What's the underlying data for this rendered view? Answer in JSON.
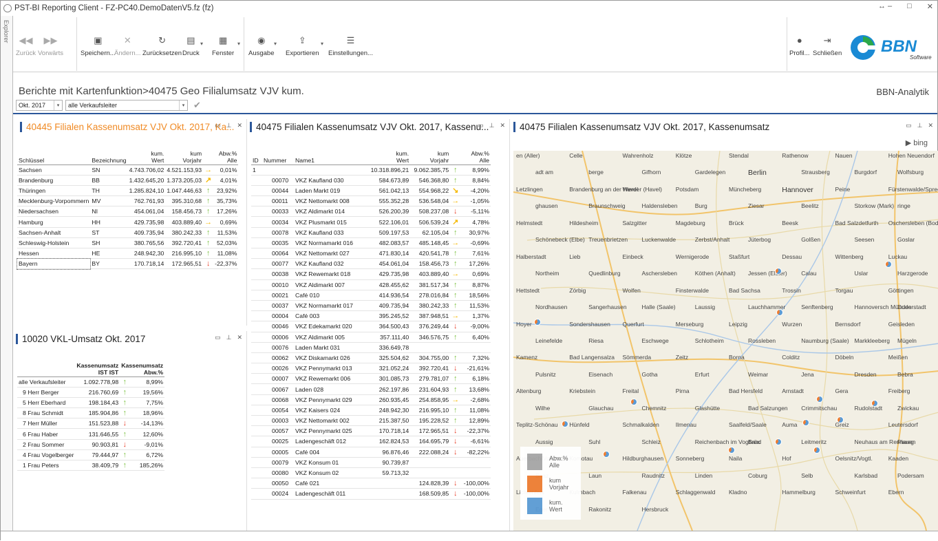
{
  "window": {
    "title": "PST-BI Reporting Client - FZ-PC40.DemoDatenV5.fz (fz)",
    "controls": [
      "↔ –",
      "□",
      "✕"
    ]
  },
  "explorer": {
    "label": "Explorer"
  },
  "toolbar": {
    "back": "Zurück",
    "forward": "Vorwärts",
    "save": "Speichern...",
    "edit": "Ändern...",
    "reset": "Zurücksetzen",
    "print": "Druck",
    "window": "Fenster",
    "output": "Ausgabe",
    "export": "Exportieren",
    "settings": "Einstellungen...",
    "profile": "Profil...",
    "close": "Schließen"
  },
  "logo": {
    "text": "BBN",
    "sub": "Software",
    "color": "#1a8ad4",
    "accent": "#2ba84a"
  },
  "breadcrumb": "Berichte mit Kartenfunktion>40475 Geo Filialumsatz VJV kum.",
  "brand_right": "BBN-Analytik",
  "filters": {
    "period": "Okt. 2017",
    "manager": "alle Verkaufsleiter"
  },
  "panel1": {
    "title": "40445 Filialen Kassenumsatz VJV Okt. 2017, Ka...",
    "headers": [
      "Schlüssel",
      "Bezeichnung",
      "kum.\nWert",
      "kum\nVorjahr",
      "Abw.%\nAlle"
    ],
    "rows": [
      [
        "Sachsen",
        "SN",
        "4.743.706,02",
        "4.521.153,93",
        "rt",
        "0,01%"
      ],
      [
        "Brandenburg",
        "BB",
        "1.432.645,20",
        "1.373.205,03",
        "ur",
        "4,01%"
      ],
      [
        "Thüringen",
        "TH",
        "1.285.824,10",
        "1.047.446,63",
        "up",
        "23,92%"
      ],
      [
        "Mecklenburg-Vorpommern",
        "MV",
        "762.761,93",
        "395.310,68",
        "up",
        "35,73%"
      ],
      [
        "Niedersachsen",
        "NI",
        "454.061,04",
        "158.456,73",
        "up",
        "17,26%"
      ],
      [
        "Hamburg",
        "HH",
        "429.735,98",
        "403.889,40",
        "rt",
        "0,69%"
      ],
      [
        "Sachsen-Anhalt",
        "ST",
        "409.735,94",
        "380.242,33",
        "up",
        "11,53%"
      ],
      [
        "Schleswig-Holstein",
        "SH",
        "380.765,56",
        "392.720,41",
        "up",
        "52,03%"
      ],
      [
        "Hessen",
        "HE",
        "248.942,30",
        "216.995,10",
        "up",
        "11,08%"
      ],
      [
        "Bayern",
        "BY",
        "170.718,14",
        "172.965,51",
        "dn",
        "-22,37%"
      ]
    ]
  },
  "panel2": {
    "title": "10020 VKL-Umsatz Okt. 2017",
    "headers": [
      "",
      "Kassenumsatz\nIST IST",
      "Kassenumsatz\nAbw.%"
    ],
    "rows": [
      [
        "alle Verkaufsleiter",
        "1.092.778,98",
        "up",
        "8,99%"
      ],
      [
        "9 Herr Berger",
        "216.760,69",
        "up",
        "19,56%"
      ],
      [
        "5 Herr Eberhard",
        "198.184,43",
        "up",
        "7,75%"
      ],
      [
        "8 Frau Schmidt",
        "185.904,86",
        "up",
        "18,96%"
      ],
      [
        "7 Herr Müller",
        "151.523,88",
        "dn",
        "-14,13%"
      ],
      [
        "6 Frau Haber",
        "131.646,55",
        "up",
        "12,60%"
      ],
      [
        "2 Frau Sommer",
        "90.903,81",
        "dn",
        "-9,01%"
      ],
      [
        "4 Frau Vogelberger",
        "79.444,97",
        "up",
        "6,72%"
      ],
      [
        "1 Frau Peters",
        "38.409,79",
        "up",
        "185,26%"
      ]
    ]
  },
  "panel3": {
    "title": "40475 Filialen Kassenumsatz VJV Okt. 2017, Kassenu...",
    "headers": [
      "ID",
      "Nummer",
      "Name1",
      "kum.\nWert",
      "kum\nVorjahr",
      "Abw.%\nAlle"
    ],
    "rows": [
      [
        "1",
        "",
        "",
        "10.318.896,21",
        "9.062.385,75",
        "up",
        "8,99%"
      ],
      [
        "",
        "00070",
        "VKZ Kaufland 030",
        "584.673,89",
        "546.368,80",
        "up",
        "8,84%"
      ],
      [
        "",
        "00044",
        "Laden Markt 019",
        "561.042,13",
        "554.968,22",
        "dr",
        "-4,20%"
      ],
      [
        "",
        "00011",
        "VKZ Nettomarkt 008",
        "555.352,28",
        "536.548,04",
        "rt",
        "-1,05%"
      ],
      [
        "",
        "00033",
        "VKZ Aldimarkt 014",
        "526.200,39",
        "508.237,08",
        "dn",
        "-5,11%"
      ],
      [
        "",
        "00034",
        "VKZ Plusmarkt 015",
        "522.106,01",
        "506.539,24",
        "ur",
        "4,78%"
      ],
      [
        "",
        "00078",
        "VKZ Kaufland 033",
        "509.197,53",
        "62.105,04",
        "up",
        "30,97%"
      ],
      [
        "",
        "00035",
        "VKZ Normamarkt 016",
        "482.083,57",
        "485.148,45",
        "rt",
        "-0,69%"
      ],
      [
        "",
        "00064",
        "VKZ Nettomarkt 027",
        "471.830,14",
        "420.541,78",
        "up",
        "7,61%"
      ],
      [
        "",
        "00077",
        "VKZ Kaufland 032",
        "454.061,04",
        "158.456,73",
        "up",
        "17,26%"
      ],
      [
        "",
        "00038",
        "VKZ Rewemarkt 018",
        "429.735,98",
        "403.889,40",
        "rt",
        "0,69%"
      ],
      [
        "",
        "00010",
        "VKZ Aldimarkt 007",
        "428.455,62",
        "381.517,34",
        "up",
        "8,87%"
      ],
      [
        "",
        "00021",
        "Café 010",
        "414.936,54",
        "278.016,84",
        "up",
        "18,56%"
      ],
      [
        "",
        "00037",
        "VKZ Normamarkt 017",
        "409.735,94",
        "380.242,33",
        "up",
        "11,53%"
      ],
      [
        "",
        "00004",
        "Café 003",
        "395.245,52",
        "387.948,51",
        "rt",
        "1,37%"
      ],
      [
        "",
        "00046",
        "VKZ Edekamarkt 020",
        "364.500,43",
        "376.249,44",
        "dn",
        "-9,00%"
      ],
      [
        "",
        "00006",
        "VKZ Aldimarkt 005",
        "357.111,40",
        "346.576,75",
        "up",
        "6,40%"
      ],
      [
        "",
        "00076",
        "Laden Markt 031",
        "336.649,78",
        "",
        "",
        ""
      ],
      [
        "",
        "00062",
        "VKZ Diskamarkt 026",
        "325.504,62",
        "304.755,00",
        "up",
        "7,32%"
      ],
      [
        "",
        "00026",
        "VKZ Pennymarkt 013",
        "321.052,24",
        "392.720,41",
        "dn",
        "-21,61%"
      ],
      [
        "",
        "00007",
        "VKZ Rewemarkt 006",
        "301.085,73",
        "279.781,07",
        "up",
        "6,18%"
      ],
      [
        "",
        "00067",
        "Laden 028",
        "262.197,86",
        "231.604,93",
        "up",
        "13,68%"
      ],
      [
        "",
        "00068",
        "VKZ Pennymarkt 029",
        "260.935,45",
        "254.858,95",
        "rt",
        "-2,68%"
      ],
      [
        "",
        "00054",
        "VKZ Kaisers 024",
        "248.942,30",
        "216.995,10",
        "up",
        "11,08%"
      ],
      [
        "",
        "00003",
        "VKZ Nettomarkt 002",
        "215.387,50",
        "195.228,52",
        "up",
        "12,89%"
      ],
      [
        "",
        "00057",
        "VKZ Pennymarkt 025",
        "170.718,14",
        "172.965,51",
        "dn",
        "-22,37%"
      ],
      [
        "",
        "00025",
        "Ladengeschäft 012",
        "162.824,53",
        "164.695,79",
        "dn",
        "-6,61%"
      ],
      [
        "",
        "00005",
        "Café 004",
        "96.876,46",
        "222.088,24",
        "dn",
        "-82,22%"
      ],
      [
        "",
        "00079",
        "VKZ Konsum 01",
        "90.739,87",
        "",
        "",
        ""
      ],
      [
        "",
        "00080",
        "VKZ Konsum 02",
        "59.713,32",
        "",
        "",
        ""
      ],
      [
        "",
        "00050",
        "Café 021",
        "",
        "124.828,39",
        "dn",
        "-100,00%"
      ],
      [
        "",
        "00024",
        "Ladengeschäft 011",
        "",
        "168.509,85",
        "dn",
        "-100,00%"
      ]
    ]
  },
  "panel4": {
    "title": "40475 Filialen Kassenumsatz VJV Okt. 2017, Kassenumsatz",
    "bing": "bing"
  },
  "map": {
    "labels": [
      "en (Aller)",
      "Celle",
      "Wahrenholz",
      "Klötze",
      "Stendal",
      "Rathenow",
      "Nauen",
      "Hohen Neuendorf",
      "adt am",
      "berge",
      "Gifhorn",
      "Gardelegen",
      "Berlin",
      "Strausberg",
      "Burgdorf",
      "Wolfsburg",
      "Letzlingen",
      "Brandenburg an der Havel",
      "Werder (Havel)",
      "Potsdam",
      "Müncheberg",
      "Hannover",
      "Peine",
      "Fürstenwalde/Spree",
      "ghausen",
      "Braunschweig",
      "Haldensleben",
      "Burg",
      "Ziesar",
      "Beelitz",
      "Storkow (Mark)",
      "ringe",
      "Helmstedt",
      "Hildesheim",
      "Salzgitter",
      "Magdeburg",
      "Brück",
      "Beesk",
      "Bad Salzdetfurth",
      "Oschersleben (Bode)",
      "Schönebeck (Elbe)",
      "Treuenbrietzen",
      "Luckenwalde",
      "Zerbst/Anhalt",
      "Jüterbog",
      "Golßen",
      "Seesen",
      "Goslar",
      "Halberstadt",
      "Lieb",
      "Einbeck",
      "Wernigerode",
      "Staßfurt",
      "Dessau",
      "Wittenberg",
      "Luckau",
      "Northeim",
      "Quedlinburg",
      "Aschersleben",
      "Köthen (Anhalt)",
      "Jessen (Elster)",
      "Calau",
      "Uslar",
      "Harzgerode",
      "Hettstedt",
      "Zörbig",
      "Wolfen",
      "Finsterwalde",
      "Bad Sachsa",
      "Trossin",
      "Torgau",
      "Göttingen",
      "Nordhausen",
      "Sangerhausen",
      "Halle (Saale)",
      "Laussig",
      "Lauchhammer",
      "Senftenberg",
      "Hannoversch Münden",
      "Duderstadt",
      "Hoyer",
      "Sondershausen",
      "Querfurt",
      "Merseburg",
      "Leipzig",
      "Wurzen",
      "Bernsdorf",
      "Geisleden",
      "Leinefelde",
      "Riesa",
      "Eschwege",
      "Schlotheim",
      "Rossleben",
      "Naumburg (Saale)",
      "Markkleeberg",
      "Mügeln",
      "Kamenz",
      "Bad Langensalza",
      "Sömmerda",
      "Zeitz",
      "Borna",
      "Colditz",
      "Döbeln",
      "Meißen",
      "Pulsnitz",
      "Eisenach",
      "Gotha",
      "Erfurt",
      "Weimar",
      "Jena",
      "Dresden",
      "Bebra",
      "Altenburg",
      "Kriebstein",
      "Freital",
      "Pirna",
      "Bad Hersfeld",
      "Arnstadt",
      "Gera",
      "Freiberg",
      "Wilhe",
      "Glauchau",
      "Chemnitz",
      "Glashütte",
      "Bad Salzungen",
      "Crimmitschau",
      "Rudolstadt",
      "Zwickau",
      "Teplitz-Schönau",
      "Hünfeld",
      "Schmalkalden",
      "Ilmenau",
      "Saalfeld/Saale",
      "Auma",
      "Greiz",
      "Leutersdorf",
      "Aussig",
      "Suhl",
      "Schleiz",
      "Reichenbach im Vogtland",
      "Brüx",
      "Leitmeritz",
      "Neuhaus am Rennweg",
      "Plauen",
      "Auerbach/Vogtl.",
      "Komotau",
      "Hildburghausen",
      "Sonneberg",
      "Naila",
      "Hof",
      "Oelsnitz/Vogtl.",
      "Kaaden",
      "Saaz",
      "Laun",
      "Raudnitz",
      "Linden",
      "Coburg",
      "Selb",
      "Karlsbad",
      "Podersam",
      "Lichtenfels",
      "Kulmbach",
      "Falkenau",
      "Schlaggenwald",
      "Kladno",
      "Hammelburg",
      "Schweinfurt",
      "Ebern",
      "Eger",
      "Rakonitz",
      "Hersbruck"
    ],
    "legend": [
      {
        "label": "Abw.%\nAlle",
        "color": "#a6a6a6"
      },
      {
        "label": "kum\nVorjahr",
        "color": "#ed7d31"
      },
      {
        "label": "kum.\nWert",
        "color": "#5b9bd5"
      }
    ]
  }
}
